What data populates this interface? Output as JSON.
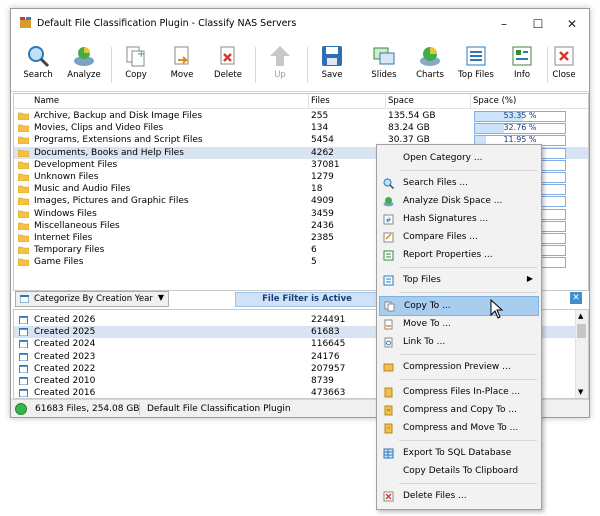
{
  "window": {
    "title": "Default File Classification Plugin - Classify NAS Servers"
  },
  "toolbar": {
    "search": "Search",
    "analyze": "Analyze",
    "copy": "Copy",
    "move": "Move",
    "delete": "Delete",
    "up": "Up",
    "save": "Save",
    "slides": "Slides",
    "charts": "Charts",
    "top_files": "Top Files",
    "info": "Info",
    "close": "Close"
  },
  "categories": {
    "headers": {
      "name": "Name",
      "files": "Files",
      "space": "Space",
      "space_pct": "Space (%)"
    },
    "rows": [
      {
        "name": "Archive, Backup and Disk Image Files",
        "files": "255",
        "space": "135.54 GB",
        "pct_label": "53.35 %",
        "pct": 53.35
      },
      {
        "name": "Movies, Clips and Video Files",
        "files": "134",
        "space": "83.24 GB",
        "pct_label": "32.76 %",
        "pct": 32.76
      },
      {
        "name": "Programs, Extensions and Script Files",
        "files": "5454",
        "space": "30.37 GB",
        "pct_label": "11.95 %",
        "pct": 11.95
      },
      {
        "name": "Documents, Books and Help Files",
        "files": "4262",
        "space": "",
        "pct_label": "",
        "pct": 0
      },
      {
        "name": "Development Files",
        "files": "37081",
        "space": "",
        "pct_label": "",
        "pct": 0
      },
      {
        "name": "Unknown Files",
        "files": "1279",
        "space": "",
        "pct_label": "",
        "pct": 0
      },
      {
        "name": "Music and Audio Files",
        "files": "18",
        "space": "",
        "pct_label": "",
        "pct": 0
      },
      {
        "name": "Images, Pictures and Graphic Files",
        "files": "4909",
        "space": "",
        "pct_label": "",
        "pct": 0
      },
      {
        "name": "Windows Files",
        "files": "3459",
        "space": "",
        "pct_label": "",
        "pct": 0
      },
      {
        "name": "Miscellaneous Files",
        "files": "2436",
        "space": "",
        "pct_label": "",
        "pct": 0
      },
      {
        "name": "Internet Files",
        "files": "2385",
        "space": "",
        "pct_label": "",
        "pct": 0
      },
      {
        "name": "Temporary Files",
        "files": "6",
        "space": "",
        "pct_label": "",
        "pct": 0
      },
      {
        "name": "Game Files",
        "files": "5",
        "space": "",
        "pct_label": "",
        "pct": 0
      }
    ],
    "selected_index": 3
  },
  "filterbar": {
    "combo": "Categorize By Creation Year",
    "filter_label": "File Filter is Active"
  },
  "years": {
    "rows": [
      {
        "name": "Created 2026",
        "files": "224491"
      },
      {
        "name": "Created 2025",
        "files": "61683"
      },
      {
        "name": "Created 2024",
        "files": "116645"
      },
      {
        "name": "Created 2023",
        "files": "24176"
      },
      {
        "name": "Created 2022",
        "files": "207957"
      },
      {
        "name": "Created 2010",
        "files": "8739"
      },
      {
        "name": "Created 2016",
        "files": "473663"
      }
    ],
    "selected_index": 1
  },
  "status": {
    "summary": "61683 Files, 254.08 GB",
    "plugin": "Default File Classification Plugin"
  },
  "menu": {
    "open_category": "Open Category ...",
    "search_files": "Search Files ...",
    "analyze_disk_space": "Analyze Disk Space ...",
    "hash_signatures": "Hash Signatures ...",
    "compare_files": "Compare Files ...",
    "report_properties": "Report Properties ...",
    "top_files": "Top Files",
    "copy_to": "Copy To ...",
    "move_to": "Move To ...",
    "link_to": "Link To ...",
    "compression_preview": "Compression Preview ...",
    "compress_in_place": "Compress Files In-Place ...",
    "compress_copy_to": "Compress and Copy To ...",
    "compress_move_to": "Compress and Move To ...",
    "export_sql": "Export To SQL Database",
    "copy_details": "Copy Details To Clipboard",
    "delete_files": "Delete Files ..."
  }
}
